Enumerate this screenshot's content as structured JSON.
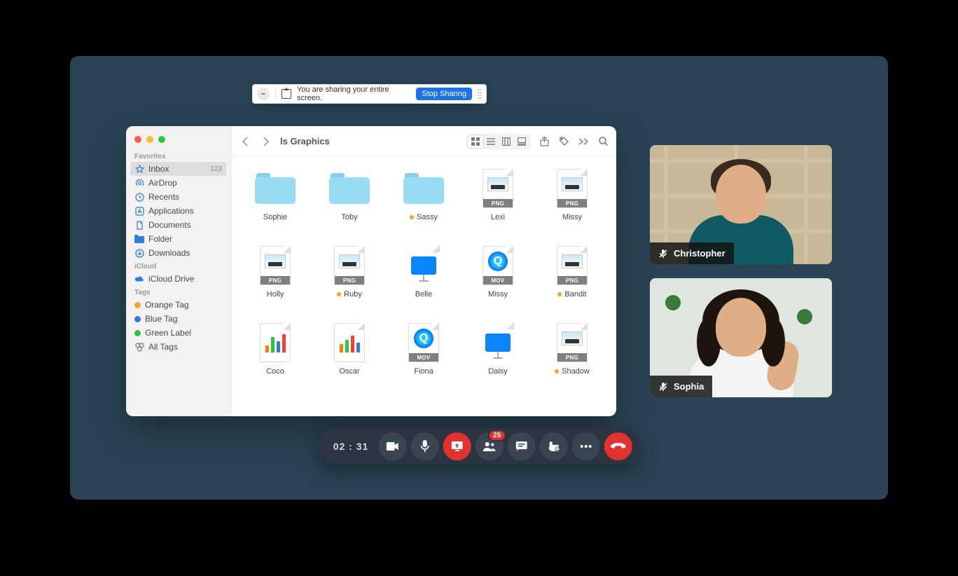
{
  "sharebar": {
    "message": "You are sharing your entire screen.",
    "stop_label": "Stop Sharing"
  },
  "finder": {
    "title": "ls Graphics",
    "sidebar": {
      "favorites_header": "Favorites",
      "icloud_header": "iCloud",
      "tags_header": "Tags",
      "favorites": [
        {
          "label": "Inbox",
          "count": "123",
          "icon": "star"
        },
        {
          "label": "AirDrop",
          "icon": "airdrop"
        },
        {
          "label": "Recents",
          "icon": "clock"
        },
        {
          "label": "Applications",
          "icon": "app"
        },
        {
          "label": "Documents",
          "icon": "doc"
        },
        {
          "label": "Folder",
          "icon": "folder"
        },
        {
          "label": "Downloads",
          "icon": "download"
        }
      ],
      "icloud": [
        {
          "label": "iCloud Drive",
          "icon": "icloud"
        }
      ],
      "tags": [
        {
          "label": "Orange Tag",
          "color": "#f5a623"
        },
        {
          "label": "Blue Tag",
          "color": "#2f7de1"
        },
        {
          "label": "Green Label",
          "color": "#28c840"
        },
        {
          "label": "All Tags",
          "icon": "alltags"
        }
      ]
    },
    "items": [
      {
        "name": "Sophie",
        "type": "folder",
        "tag": null
      },
      {
        "name": "Toby",
        "type": "folder",
        "tag": null
      },
      {
        "name": "Sassy",
        "type": "folder",
        "tag": "#f5a623"
      },
      {
        "name": "Lexi",
        "type": "png",
        "tag": null
      },
      {
        "name": "Missy",
        "type": "png",
        "tag": null
      },
      {
        "name": "Holly",
        "type": "png",
        "tag": null
      },
      {
        "name": "Ruby",
        "type": "png",
        "tag": "#f5a623"
      },
      {
        "name": "Belle",
        "type": "keynote",
        "tag": null
      },
      {
        "name": "Missy",
        "type": "mov",
        "tag": null
      },
      {
        "name": "Bandit",
        "type": "png",
        "tag": "#f5a623"
      },
      {
        "name": "Coco",
        "type": "chart",
        "tag": null,
        "bars": [
          {
            "h": 10,
            "c": "#ff7a00"
          },
          {
            "h": 22,
            "c": "#28c840"
          },
          {
            "h": 16,
            "c": "#2f7de1"
          },
          {
            "h": 26,
            "c": "#ff3b30"
          }
        ]
      },
      {
        "name": "Oscar",
        "type": "chart",
        "tag": null,
        "bars": [
          {
            "h": 12,
            "c": "#ff7a00"
          },
          {
            "h": 18,
            "c": "#28c840"
          },
          {
            "h": 24,
            "c": "#ff3b30"
          },
          {
            "h": 14,
            "c": "#2f7de1"
          }
        ]
      },
      {
        "name": "Fiona",
        "type": "movfile",
        "tag": null
      },
      {
        "name": "Daisy",
        "type": "keynote",
        "tag": null
      },
      {
        "name": "Shadow",
        "type": "png",
        "tag": "#f5a623"
      }
    ]
  },
  "participants": [
    {
      "name": "Christopher",
      "muted": true
    },
    {
      "name": "Sophia",
      "muted": true
    }
  ],
  "callbar": {
    "timer": "02 : 31",
    "badge_participants": "25"
  }
}
